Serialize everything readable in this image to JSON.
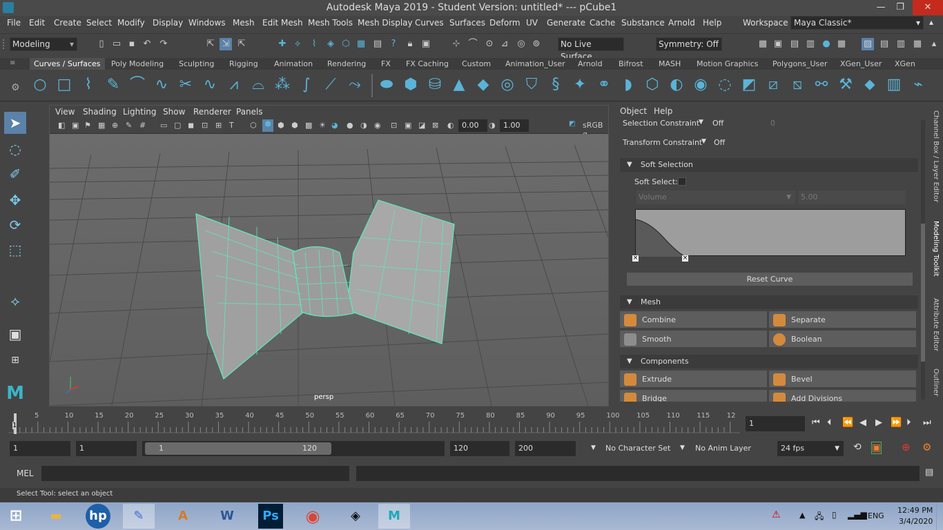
{
  "titlebar": {
    "title": "Autodesk Maya 2019 - Student Version: untitled*    ---    pCube1",
    "minimize": "—",
    "restore": "❐",
    "close": "✕"
  },
  "menus": [
    "File",
    "Edit",
    "Create",
    "Select",
    "Modify",
    "Display",
    "Windows",
    "Mesh",
    "Edit Mesh",
    "Mesh Tools",
    "Mesh Display",
    "Curves",
    "Surfaces",
    "Deform",
    "UV",
    "Generate",
    "Cache",
    "Substance",
    "Arnold",
    "Help"
  ],
  "workspace": {
    "label": "Workspace :",
    "value": "Maya Classic*"
  },
  "statusline": {
    "mode": "Modeling",
    "live_surface": "No Live Surface",
    "symmetry": "Symmetry: Off"
  },
  "shelf_tabs": [
    "Curves / Surfaces",
    "Poly Modeling",
    "Sculpting",
    "Rigging",
    "Animation",
    "Rendering",
    "FX",
    "FX Caching",
    "Custom",
    "Animation_User",
    "Arnold",
    "Bifrost",
    "MASH",
    "Motion Graphics",
    "Polygons_User",
    "XGen_User",
    "XGen"
  ],
  "viewport": {
    "menus": [
      "View",
      "Shading",
      "Lighting",
      "Show",
      "Renderer",
      "Panels"
    ],
    "exposure": "0.00",
    "gamma": "1.00",
    "colorspace": "sRGB g",
    "camera": "persp"
  },
  "modeling_toolkit": {
    "menus": [
      "Object",
      "Help"
    ],
    "selection_constraint": {
      "label": "Selection Constraint",
      "value": "Off",
      "extra": "0"
    },
    "transform_constraint": {
      "label": "Transform Constraint",
      "value": "Off"
    },
    "soft_selection": {
      "header": "Soft Selection",
      "soft_select_label": "Soft Select:",
      "falloff_mode": "Volume",
      "falloff_radius": "5.00",
      "reset_curve": "Reset Curve"
    },
    "mesh": {
      "header": "Mesh",
      "buttons": [
        "Combine",
        "Separate",
        "Smooth",
        "Boolean"
      ]
    },
    "components": {
      "header": "Components",
      "buttons": [
        "Extrude",
        "Bevel",
        "Bridge",
        "Add Divisions"
      ]
    }
  },
  "side_tabs": [
    "Channel Box / Layer Editor",
    "Modeling Toolkit",
    "Attribute Editor",
    "Outliner"
  ],
  "timeline": {
    "ticks": [
      "5",
      "10",
      "15",
      "20",
      "25",
      "30",
      "35",
      "40",
      "45",
      "50",
      "55",
      "60",
      "65",
      "70",
      "75",
      "80",
      "85",
      "90",
      "95",
      "100",
      "105",
      "110",
      "115",
      "12"
    ],
    "start_marker": "1",
    "current_frame": "1"
  },
  "range": {
    "start_field": "1",
    "playback_start": "1",
    "slider_start": "1",
    "slider_end": "120",
    "playback_end": "120",
    "end_field": "200",
    "character_set": "No Character Set",
    "anim_layer": "No Anim Layer",
    "fps": "24 fps"
  },
  "cmdline": {
    "label": "MEL"
  },
  "helpline": {
    "text": "Select Tool: select an object"
  },
  "taskbar": {
    "lang": "ENG",
    "time": "12:49 PM",
    "date": "3/4/2020"
  }
}
